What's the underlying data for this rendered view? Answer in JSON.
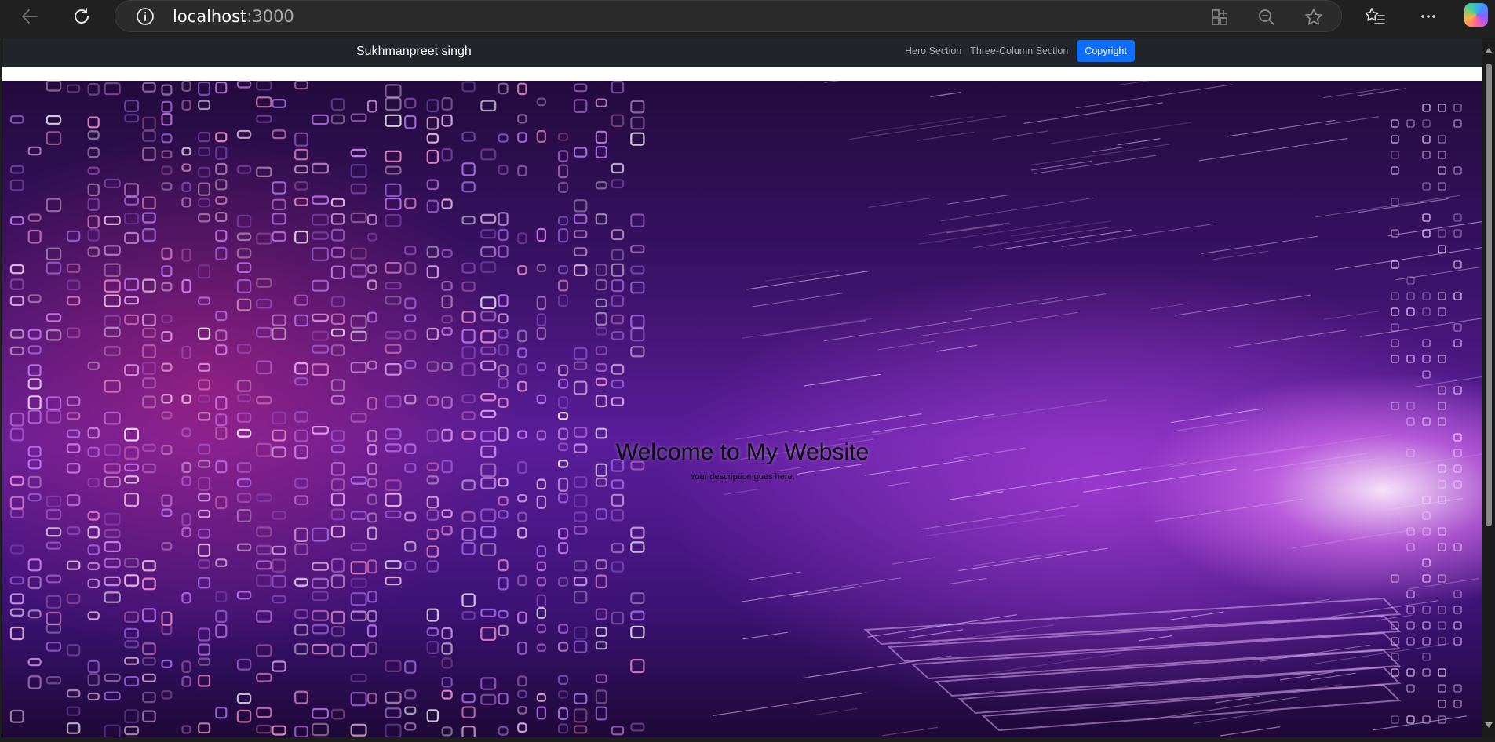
{
  "browser": {
    "url_host": "localhost",
    "url_port": ":3000",
    "icons": [
      "back-arrow-icon",
      "refresh-icon",
      "site-info-icon",
      "extensions-icon",
      "zoom-icon",
      "favorite-star-icon",
      "favorites-icon",
      "more-icon",
      "copilot-icon"
    ]
  },
  "navbar": {
    "brand": "Sukhmanpreet singh",
    "links": [
      {
        "label": "Hero Section"
      },
      {
        "label": "Three-Column Section"
      },
      {
        "label": "Copyright"
      }
    ],
    "active_color": "#0d6efd",
    "background_color": "#212529"
  },
  "hero": {
    "title": "Welcome to My Website",
    "description": "Your description goes here."
  }
}
